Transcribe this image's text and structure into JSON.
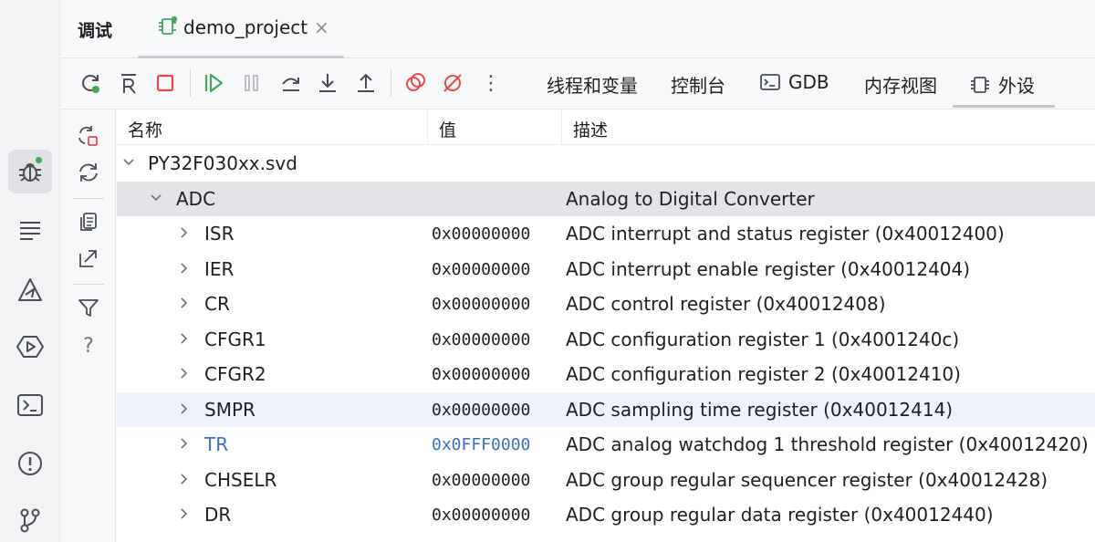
{
  "panel": {
    "title": "调试"
  },
  "file_tab": {
    "label": "demo_project",
    "close": "×"
  },
  "toolbar": {
    "buttons": [
      "rerun-icon",
      "restart-icon",
      "stop-icon",
      "resume-icon",
      "pause-icon",
      "step-over-icon",
      "step-into-icon",
      "step-out-icon",
      "breakpoints-icon",
      "mute-breakpoints-icon",
      "more-icon"
    ],
    "more_label": "⋮"
  },
  "view_tabs": {
    "threads": "线程和变量",
    "console": "控制台",
    "gdb": "GDB",
    "memory": "内存视图",
    "peripherals": "外设"
  },
  "table": {
    "headers": {
      "name": "名称",
      "value": "值",
      "description": "描述"
    },
    "root": {
      "name": "PY32F030xx.svd"
    },
    "group": {
      "name": "ADC",
      "description": "Analog to Digital Converter"
    },
    "rows": [
      {
        "name": "ISR",
        "value": "0x00000000",
        "description": "ADC interrupt and status register (0x40012400)"
      },
      {
        "name": "IER",
        "value": "0x00000000",
        "description": "ADC interrupt enable register (0x40012404)"
      },
      {
        "name": "CR",
        "value": "0x00000000",
        "description": "ADC control register (0x40012408)"
      },
      {
        "name": "CFGR1",
        "value": "0x00000000",
        "description": "ADC configuration register 1 (0x4001240c)"
      },
      {
        "name": "CFGR2",
        "value": "0x00000000",
        "description": "ADC configuration register 2 (0x40012410)"
      },
      {
        "name": "SMPR",
        "value": "0x00000000",
        "description": "ADC sampling time register (0x40012414)"
      },
      {
        "name": "TR",
        "value": "0x0FFF0000",
        "description": "ADC analog watchdog 1 threshold register (0x40012420)"
      },
      {
        "name": "CHSELR",
        "value": "0x00000000",
        "description": "ADC group regular sequencer register (0x40012428)"
      },
      {
        "name": "DR",
        "value": "0x00000000",
        "description": "ADC group regular data register (0x40012440)"
      }
    ]
  },
  "colors": {
    "accent_green": "#3fa85a",
    "stop_red": "#e5484d",
    "changed_blue": "#3b6fc1"
  },
  "help_label": "?"
}
